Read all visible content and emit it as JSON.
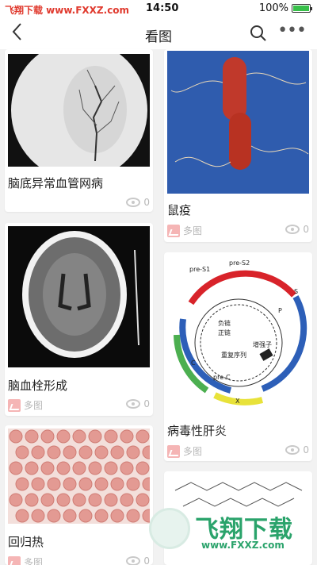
{
  "status": {
    "watermark": "飞翔下载 www.FXXZ.com",
    "time": "14:50",
    "battery": "100%",
    "battery_level": 1.0
  },
  "nav": {
    "back_icon": "chevron-left-icon",
    "title": "看图",
    "search_icon": "search-icon",
    "more_icon": "more-dots-icon"
  },
  "cards": [
    {
      "caption": "脑底异常血管网病",
      "views": "0"
    },
    {
      "caption": "鼠疫",
      "tag": "多图",
      "views": "0"
    },
    {
      "caption": "脑血栓形成",
      "tag": "多图",
      "views": "0"
    },
    {
      "caption": "病毒性肝炎",
      "tag": "多图",
      "views": "0"
    },
    {
      "caption": "回归热",
      "tag": "多图",
      "views": "0"
    }
  ],
  "diagram": {
    "labels": [
      "pre-S1",
      "pre-S2",
      "S",
      "P",
      "负链",
      "正链",
      "增强子",
      "重复序列",
      "pre-C",
      "C",
      "X"
    ]
  },
  "brand": {
    "name": "飞翔下载",
    "url": "www.FXXZ.com"
  }
}
